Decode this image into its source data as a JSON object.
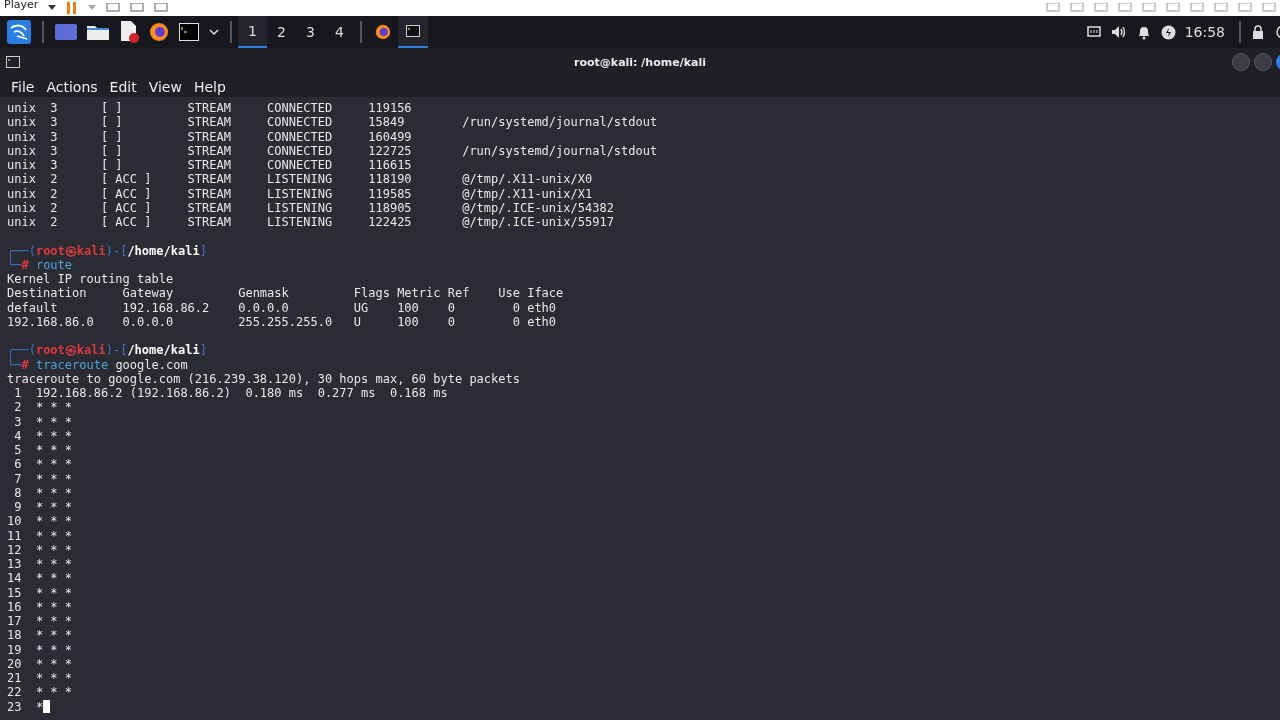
{
  "player_bar": {
    "label": "Player"
  },
  "taskbar": {
    "workspaces": [
      {
        "label": "1",
        "selected": true
      },
      {
        "label": "2",
        "selected": false
      },
      {
        "label": "3",
        "selected": false
      },
      {
        "label": "4",
        "selected": false
      }
    ],
    "tasks": [
      {
        "kind": "browser",
        "selected": false
      },
      {
        "kind": "terminal",
        "selected": true
      }
    ],
    "clock": "16:58"
  },
  "window": {
    "title": "root@kali: /home/kali"
  },
  "menu": [
    "File",
    "Actions",
    "Edit",
    "View",
    "Help"
  ],
  "terminal": {
    "cursor": true,
    "lines": [
      {
        "kind": "output",
        "text": "unix  3      [ ]         STREAM     CONNECTED     119156"
      },
      {
        "kind": "output",
        "text": "unix  3      [ ]         STREAM     CONNECTED     15849        /run/systemd/journal/stdout"
      },
      {
        "kind": "output",
        "text": "unix  3      [ ]         STREAM     CONNECTED     160499"
      },
      {
        "kind": "output",
        "text": "unix  3      [ ]         STREAM     CONNECTED     122725       /run/systemd/journal/stdout"
      },
      {
        "kind": "output",
        "text": "unix  3      [ ]         STREAM     CONNECTED     116615"
      },
      {
        "kind": "output",
        "text": "unix  2      [ ACC ]     STREAM     LISTENING     118190       @/tmp/.X11-unix/X0"
      },
      {
        "kind": "output",
        "text": "unix  2      [ ACC ]     STREAM     LISTENING     119585       @/tmp/.X11-unix/X1"
      },
      {
        "kind": "output",
        "text": "unix  2      [ ACC ]     STREAM     LISTENING     118905       @/tmp/.ICE-unix/54382"
      },
      {
        "kind": "output",
        "text": "unix  2      [ ACC ]     STREAM     LISTENING     122425       @/tmp/.ICE-unix/55917"
      },
      {
        "kind": "blank"
      },
      {
        "kind": "prompt",
        "open": "┌──(",
        "user": "root㉿kali",
        "mid": ")-[",
        "path": "/home/kali",
        "close": "]"
      },
      {
        "kind": "command",
        "lead": "└─",
        "symbol": "#",
        "command": "route"
      },
      {
        "kind": "output",
        "text": "Kernel IP routing table"
      },
      {
        "kind": "output",
        "text": "Destination     Gateway         Genmask         Flags Metric Ref    Use Iface"
      },
      {
        "kind": "output",
        "text": "default         192.168.86.2    0.0.0.0         UG    100    0        0 eth0"
      },
      {
        "kind": "output",
        "text": "192.168.86.0    0.0.0.0         255.255.255.0   U     100    0        0 eth0"
      },
      {
        "kind": "blank"
      },
      {
        "kind": "prompt",
        "open": "┌──(",
        "user": "root㉿kali",
        "mid": ")-[",
        "path": "/home/kali",
        "close": "]"
      },
      {
        "kind": "command",
        "lead": "└─",
        "symbol": "#",
        "command": "traceroute",
        "args": "google.com"
      },
      {
        "kind": "output",
        "text": "traceroute to google.com (216.239.38.120), 30 hops max, 60 byte packets"
      },
      {
        "kind": "output",
        "text": " 1  192.168.86.2 (192.168.86.2)  0.180 ms  0.277 ms  0.168 ms"
      },
      {
        "kind": "output",
        "text": " 2  * * *"
      },
      {
        "kind": "output",
        "text": " 3  * * *"
      },
      {
        "kind": "output",
        "text": " 4  * * *"
      },
      {
        "kind": "output",
        "text": " 5  * * *"
      },
      {
        "kind": "output",
        "text": " 6  * * *"
      },
      {
        "kind": "output",
        "text": " 7  * * *"
      },
      {
        "kind": "output",
        "text": " 8  * * *"
      },
      {
        "kind": "output",
        "text": " 9  * * *"
      },
      {
        "kind": "output",
        "text": "10  * * *"
      },
      {
        "kind": "output",
        "text": "11  * * *"
      },
      {
        "kind": "output",
        "text": "12  * * *"
      },
      {
        "kind": "output",
        "text": "13  * * *"
      },
      {
        "kind": "output",
        "text": "14  * * *"
      },
      {
        "kind": "output",
        "text": "15  * * *"
      },
      {
        "kind": "output",
        "text": "16  * * *"
      },
      {
        "kind": "output",
        "text": "17  * * *"
      },
      {
        "kind": "output",
        "text": "18  * * *"
      },
      {
        "kind": "output",
        "text": "19  * * *"
      },
      {
        "kind": "output",
        "text": "20  * * *"
      },
      {
        "kind": "output",
        "text": "21  * * *"
      },
      {
        "kind": "output",
        "text": "22  * * *"
      },
      {
        "kind": "output",
        "text": "23  *"
      }
    ]
  }
}
